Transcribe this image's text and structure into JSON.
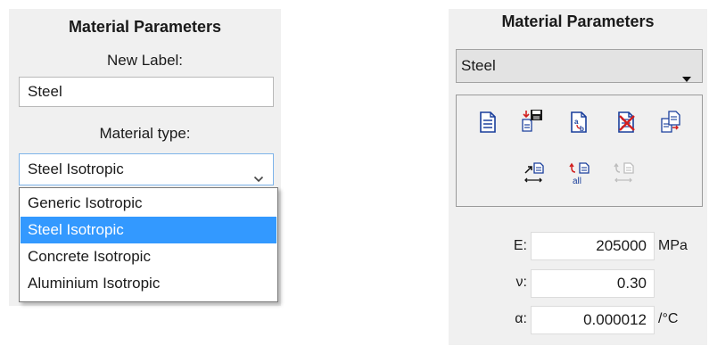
{
  "left_panel": {
    "title": "Material Parameters",
    "new_label_caption": "New Label:",
    "label_value": "Steel",
    "material_type_caption": "Material type:",
    "material_type_selected": "Steel Isotropic",
    "options": [
      {
        "label": "Generic Isotropic",
        "selected": false
      },
      {
        "label": "Steel Isotropic",
        "selected": true
      },
      {
        "label": "Concrete Isotropic",
        "selected": false
      },
      {
        "label": "Aluminium Isotropic",
        "selected": false
      }
    ]
  },
  "right_panel": {
    "title": "Material Parameters",
    "material_selected": "Steel",
    "toolbar_icons": [
      "new-material-icon",
      "save-material-icon",
      "rename-material-icon",
      "delete-material-icon",
      "copy-material-icon",
      "apply-material-icon",
      "apply-all-icon",
      "apply-disabled-icon"
    ],
    "properties": [
      {
        "label": "E:",
        "value": "205000",
        "unit": "MPa"
      },
      {
        "label": "ν:",
        "value": "0.30",
        "unit": ""
      },
      {
        "label": "α:",
        "value": "0.000012",
        "unit": "/°C"
      }
    ]
  },
  "colors": {
    "panel_bg": "#f0f0f0",
    "selection": "#3399ff",
    "focus_border": "#7eb4ea",
    "icon_blue": "#1a3f9c",
    "icon_red": "#d21f1f"
  }
}
